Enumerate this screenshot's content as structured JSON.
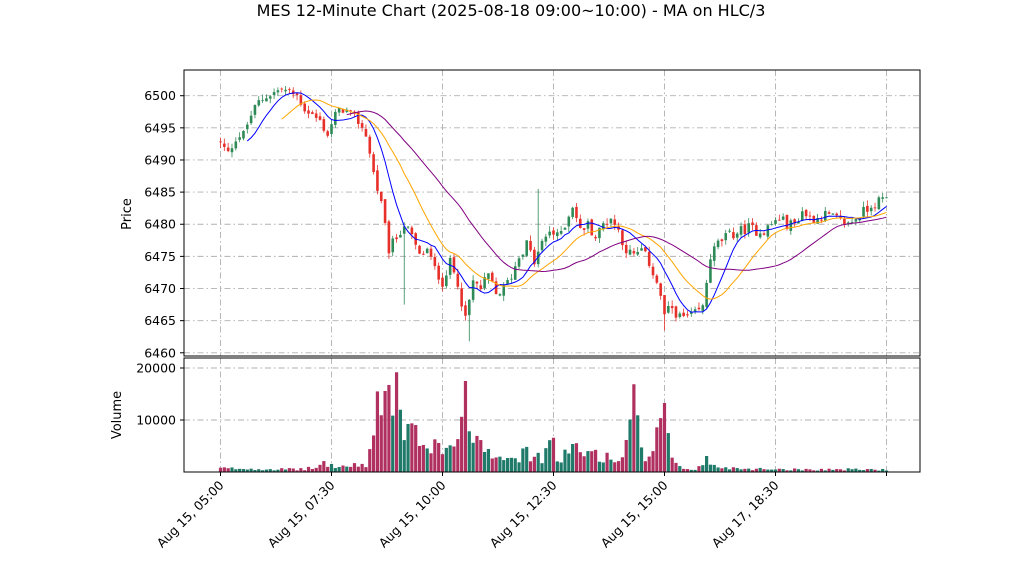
{
  "chart_data": {
    "type": "candlestick",
    "title": "MES 12-Minute Chart (2025-08-18 09:00~10:00) - MA on HLC/3",
    "price_panel": {
      "ylabel": "Price",
      "ylim": [
        6459.5,
        6504.0
      ],
      "yticks": [
        6460,
        6465,
        6470,
        6475,
        6480,
        6485,
        6490,
        6495,
        6500
      ],
      "grid": true
    },
    "volume_panel": {
      "ylabel": "Volume",
      "ylim": [
        0,
        20000
      ],
      "yticks": [
        10000,
        20000
      ],
      "grid": true
    },
    "x_ticks": [
      {
        "label": "Aug 15, 05:00",
        "bar": 0
      },
      {
        "label": "Aug 15, 07:30",
        "bar": 29
      },
      {
        "label": "Aug 15, 10:00",
        "bar": 58
      },
      {
        "label": "Aug 15, 12:30",
        "bar": 87
      },
      {
        "label": "Aug 15, 15:00",
        "bar": 116
      },
      {
        "label": "Aug 17, 18:30",
        "bar": 145
      },
      {
        "label": "",
        "bar": 174
      }
    ],
    "bar_count": 175,
    "colors": {
      "up": "#2e8b57",
      "down": "#e8302a",
      "volume_up": "#1f7a6a",
      "volume_down": "#b03060",
      "ma_fast": "#0000ff",
      "ma_mid": "#ffa500",
      "ma_slow": "#800080"
    },
    "close_anchors": [
      [
        0,
        6492.5
      ],
      [
        2,
        6491
      ],
      [
        4,
        6493.5
      ],
      [
        6,
        6494
      ],
      [
        8,
        6497
      ],
      [
        10,
        6499
      ],
      [
        12,
        6500
      ],
      [
        14,
        6500.5
      ],
      [
        16,
        6501
      ],
      [
        18,
        6500.5
      ],
      [
        20,
        6500
      ],
      [
        22,
        6498
      ],
      [
        24,
        6497
      ],
      [
        26,
        6496
      ],
      [
        28,
        6494
      ],
      [
        30,
        6497
      ],
      [
        32,
        6498
      ],
      [
        34,
        6497
      ],
      [
        36,
        6496
      ],
      [
        38,
        6494
      ],
      [
        40,
        6488
      ],
      [
        42,
        6483
      ],
      [
        44,
        6476
      ],
      [
        46,
        6478
      ],
      [
        48,
        6480
      ],
      [
        50,
        6478
      ],
      [
        52,
        6475
      ],
      [
        54,
        6476
      ],
      [
        56,
        6473
      ],
      [
        58,
        6471
      ],
      [
        60,
        6474
      ],
      [
        62,
        6471
      ],
      [
        64,
        6465
      ],
      [
        66,
        6471
      ],
      [
        68,
        6470
      ],
      [
        70,
        6472
      ],
      [
        72,
        6469
      ],
      [
        74,
        6470
      ],
      [
        76,
        6472
      ],
      [
        78,
        6475
      ],
      [
        80,
        6477
      ],
      [
        82,
        6474
      ],
      [
        84,
        6477
      ],
      [
        86,
        6479
      ],
      [
        88,
        6478
      ],
      [
        90,
        6480
      ],
      [
        92,
        6483
      ],
      [
        94,
        6479
      ],
      [
        96,
        6480
      ],
      [
        98,
        6478
      ],
      [
        100,
        6480
      ],
      [
        102,
        6481
      ],
      [
        104,
        6479
      ],
      [
        106,
        6476
      ],
      [
        108,
        6475
      ],
      [
        110,
        6476
      ],
      [
        112,
        6474
      ],
      [
        114,
        6471
      ],
      [
        116,
        6466
      ],
      [
        118,
        6467
      ],
      [
        120,
        6465.5
      ],
      [
        122,
        6465.5
      ],
      [
        124,
        6466
      ],
      [
        126,
        6467
      ],
      [
        128,
        6475
      ],
      [
        130,
        6477
      ],
      [
        132,
        6478
      ],
      [
        134,
        6478.5
      ],
      [
        136,
        6479
      ],
      [
        138,
        6479.5
      ],
      [
        140,
        6479
      ],
      [
        142,
        6479
      ],
      [
        144,
        6480
      ],
      [
        146,
        6481
      ],
      [
        148,
        6480
      ],
      [
        150,
        6480
      ],
      [
        152,
        6482
      ],
      [
        154,
        6481
      ],
      [
        156,
        6481
      ],
      [
        158,
        6481.5
      ],
      [
        160,
        6481
      ],
      [
        162,
        6480.5
      ],
      [
        164,
        6480
      ],
      [
        166,
        6481
      ],
      [
        168,
        6482
      ],
      [
        170,
        6483
      ],
      [
        172,
        6483.5
      ],
      [
        174,
        6484
      ]
    ],
    "volume_anchors": [
      [
        0,
        700
      ],
      [
        10,
        600
      ],
      [
        20,
        500
      ],
      [
        25,
        800
      ],
      [
        27,
        1800
      ],
      [
        29,
        1200
      ],
      [
        32,
        1000
      ],
      [
        38,
        1400
      ],
      [
        40,
        6500
      ],
      [
        41,
        17000
      ],
      [
        42,
        12000
      ],
      [
        43,
        17500
      ],
      [
        44,
        14000
      ],
      [
        45,
        8000
      ],
      [
        46,
        18200
      ],
      [
        47,
        10500
      ],
      [
        48,
        6000
      ],
      [
        50,
        7500
      ],
      [
        52,
        6500
      ],
      [
        55,
        5500
      ],
      [
        56,
        7500
      ],
      [
        58,
        4500
      ],
      [
        60,
        5000
      ],
      [
        62,
        7500
      ],
      [
        64,
        12200
      ],
      [
        65,
        9000
      ],
      [
        66,
        9700
      ],
      [
        68,
        5500
      ],
      [
        70,
        4800
      ],
      [
        72,
        3500
      ],
      [
        75,
        4000
      ],
      [
        78,
        3000
      ],
      [
        80,
        3500
      ],
      [
        84,
        2500
      ],
      [
        86,
        6800
      ],
      [
        88,
        2500
      ],
      [
        92,
        4500
      ],
      [
        95,
        3000
      ],
      [
        97,
        4500
      ],
      [
        100,
        3000
      ],
      [
        104,
        2000
      ],
      [
        106,
        5500
      ],
      [
        107,
        8800
      ],
      [
        108,
        12500
      ],
      [
        110,
        3500
      ],
      [
        112,
        2500
      ],
      [
        115,
        8000
      ],
      [
        116,
        13300
      ],
      [
        117,
        6500
      ],
      [
        118,
        2000
      ],
      [
        120,
        800
      ],
      [
        122,
        600
      ],
      [
        124,
        600
      ],
      [
        126,
        1200
      ],
      [
        127,
        3500
      ],
      [
        128,
        1200
      ],
      [
        130,
        1000
      ],
      [
        135,
        700
      ],
      [
        140,
        600
      ],
      [
        145,
        600
      ],
      [
        150,
        500
      ],
      [
        155,
        500
      ],
      [
        160,
        500
      ],
      [
        165,
        500
      ],
      [
        170,
        500
      ],
      [
        174,
        400
      ]
    ]
  }
}
